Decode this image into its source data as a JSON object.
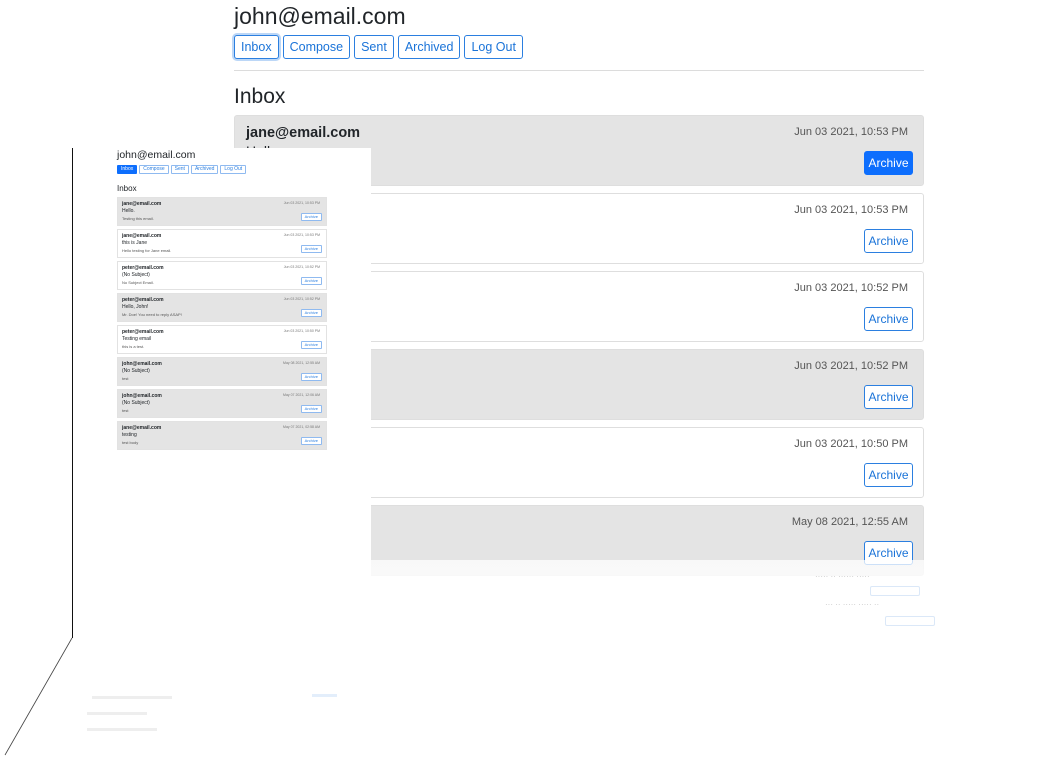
{
  "big": {
    "user": "john@email.com",
    "nav": [
      "Inbox",
      "Compose",
      "Sent",
      "Archived",
      "Log Out"
    ],
    "heading": "Inbox",
    "archive_label": "Archive",
    "mails": [
      {
        "from": "jane@email.com",
        "subject": "Hello",
        "body": "",
        "time": "Jun 03 2021, 10:53 PM",
        "read": true
      },
      {
        "from": "",
        "subject": "",
        "body": "ail.",
        "time": "Jun 03 2021, 10:53 PM",
        "read": false
      },
      {
        "from": "",
        "subject": "",
        "body": "",
        "time": "Jun 03 2021, 10:52 PM",
        "read": false
      },
      {
        "from": "",
        "subject": "",
        "body": "ly ASAP!",
        "time": "Jun 03 2021, 10:52 PM",
        "read": true
      },
      {
        "from": "",
        "subject": "",
        "body": "",
        "time": "Jun 03 2021, 10:50 PM",
        "read": false
      },
      {
        "from": "",
        "subject": "",
        "body": "",
        "time": "May 08 2021, 12:55 AM",
        "read": true
      }
    ]
  },
  "small": {
    "user": "john@email.com",
    "nav": [
      "Inbox",
      "Compose",
      "Sent",
      "Archived",
      "Log Out"
    ],
    "heading": "Inbox",
    "archive_label": "Archive",
    "mails": [
      {
        "from": "jane@email.com",
        "subject": "Hello.",
        "body": "Testing this email.",
        "time": "Jun 03 2021, 10:53 PM",
        "read": true
      },
      {
        "from": "jane@email.com",
        "subject": "this is Jane",
        "body": "Hello testing for Jane email.",
        "time": "Jun 03 2021, 10:53 PM",
        "read": false
      },
      {
        "from": "peter@email.com",
        "subject": "(No Subject)",
        "body": "No Subject Email.",
        "time": "Jun 03 2021, 10:52 PM",
        "read": false
      },
      {
        "from": "peter@email.com",
        "subject": "Hello, John!",
        "body": "Mr. Doe! You need to reply ASAP!",
        "time": "Jun 03 2021, 10:52 PM",
        "read": true
      },
      {
        "from": "peter@email.com",
        "subject": "Testing email",
        "body": "this is a test.",
        "time": "Jun 03 2021, 10:50 PM",
        "read": false
      },
      {
        "from": "john@email.com",
        "subject": "(No Subject)",
        "body": "test",
        "time": "May 08 2021, 12:55 AM",
        "read": true
      },
      {
        "from": "john@email.com",
        "subject": "(No Subject)",
        "body": "test",
        "time": "May 07 2021, 12:06 AM",
        "read": true
      },
      {
        "from": "jane@email.com",
        "subject": "testing",
        "body": "test body",
        "time": "May 07 2021, 02:58 AM",
        "read": true
      }
    ]
  },
  "colors": {
    "accent": "#0d6efd",
    "read_bg": "#e4e4e4",
    "border": "#dedede"
  }
}
